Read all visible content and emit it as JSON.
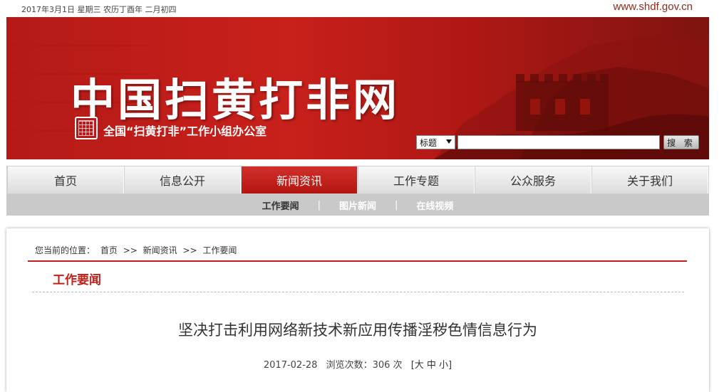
{
  "topbar": {
    "date": "2017年3月1日 星期三 农历丁酉年 二月初四",
    "site_url": "www.shdf.gov.cn"
  },
  "banner": {
    "title": "中国扫黄打非网",
    "office": "全国“扫黄打非”工作小组办公室",
    "search": {
      "select_value": "标题",
      "input_value": "",
      "button_label": "搜 索"
    }
  },
  "nav": {
    "items": [
      {
        "label": "首页"
      },
      {
        "label": "信息公开"
      },
      {
        "label": "新闻资讯"
      },
      {
        "label": "工作专题"
      },
      {
        "label": "公众服务"
      },
      {
        "label": "关于我们"
      }
    ],
    "active_index": 2,
    "sub_items": [
      {
        "label": "工作要闻"
      },
      {
        "label": "图片新闻"
      },
      {
        "label": "在线视频"
      }
    ],
    "sub_separator": "|"
  },
  "content": {
    "breadcrumb": {
      "prefix": "您当前的位置：",
      "home": "首页",
      "sep": ">>",
      "level1": "新闻资讯",
      "level2": "工作要闻"
    },
    "section_title": "工作要闻",
    "article": {
      "title": "坚决打击利用网络新技术新应用传播淫秽色情信息行为",
      "date": "2017-02-28",
      "views_label": "浏览次数：306 次",
      "font_size_links": "[大 中 小]"
    }
  },
  "colors": {
    "brand_red": "#c0201a",
    "nav_active": "#c41a14",
    "subnav_bg": "#c9c9c9"
  }
}
